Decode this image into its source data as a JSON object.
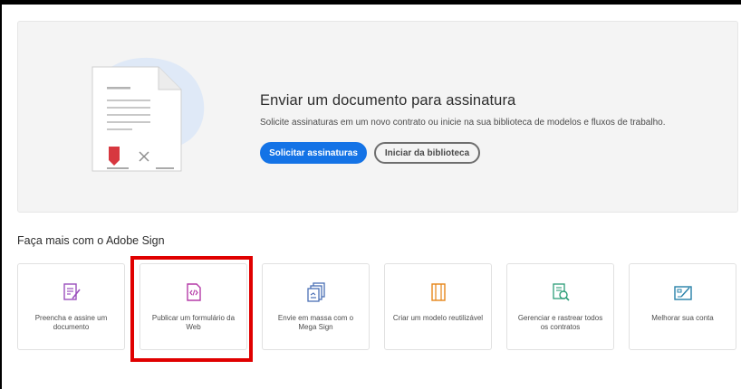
{
  "hero": {
    "title": "Enviar um documento para assinatura",
    "subtitle": "Solicite assinaturas em um novo contrato ou inicie na sua biblioteca de modelos e fluxos de trabalho.",
    "primary_button": "Solicitar assinaturas",
    "secondary_button": "Iniciar da biblioteca"
  },
  "section": {
    "title": "Faça mais com o Adobe Sign"
  },
  "cards": [
    {
      "label": "Preencha e assine um documento",
      "icon": "fill-sign-icon",
      "color": "#9b4fbd"
    },
    {
      "label": "Publicar um formulário da Web",
      "icon": "web-form-icon",
      "color": "#b53ca8"
    },
    {
      "label": "Envie em massa com o Mega Sign",
      "icon": "mega-sign-icon",
      "color": "#4a6fb5"
    },
    {
      "label": "Criar um modelo reutilizável",
      "icon": "template-icon",
      "color": "#e68619"
    },
    {
      "label": "Gerenciar e rastrear todos os contratos",
      "icon": "manage-icon",
      "color": "#2d9d78"
    },
    {
      "label": "Melhorar sua conta",
      "icon": "upgrade-icon",
      "color": "#2680a8"
    }
  ],
  "colors": {
    "accent": "#1473e6",
    "highlight": "#e00000",
    "signature_red": "#d7373f"
  }
}
